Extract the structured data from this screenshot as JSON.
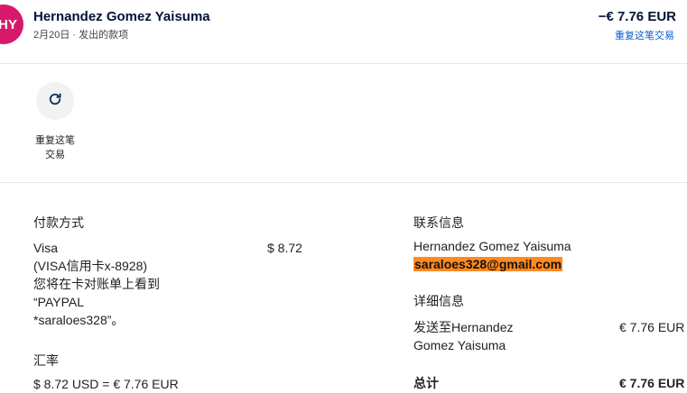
{
  "header": {
    "avatar_initials": "HY",
    "name": "Hernandez Gomez Yaisuma",
    "subtitle": "2月20日 · 发出的款项",
    "amount": "−€ 7.76 EUR",
    "repeat_link": "重复这笔交易"
  },
  "actions": {
    "repeat_label_line1": "重复这笔",
    "repeat_label_line2": "交易",
    "icon": "refresh-icon"
  },
  "payment": {
    "heading": "付款方式",
    "method": "Visa",
    "card": "(VISA信用卡x-8928)",
    "note_line1": "您将在卡对账单上看到",
    "note_line2": "“PAYPAL",
    "note_line3": "*saraloes328”。",
    "amount": "$ 8.72"
  },
  "exchange": {
    "heading": "汇率",
    "value": "$ 8.72 USD = € 7.76 EUR"
  },
  "contact": {
    "heading": "联系信息",
    "name": "Hernandez Gomez Yaisuma",
    "email": "saraloes328@gmail.com"
  },
  "details": {
    "heading": "详细信息",
    "sent_to_line1": "发送至Hernandez",
    "sent_to_line2": "Gomez Yaisuma",
    "sent_amount": "€ 7.76 EUR",
    "total_label": "总计",
    "total_amount": "€ 7.76 EUR"
  },
  "colors": {
    "avatar_bg": "#d6196b",
    "link": "#0a5bd1",
    "email_highlight": "#ff8a1f"
  }
}
